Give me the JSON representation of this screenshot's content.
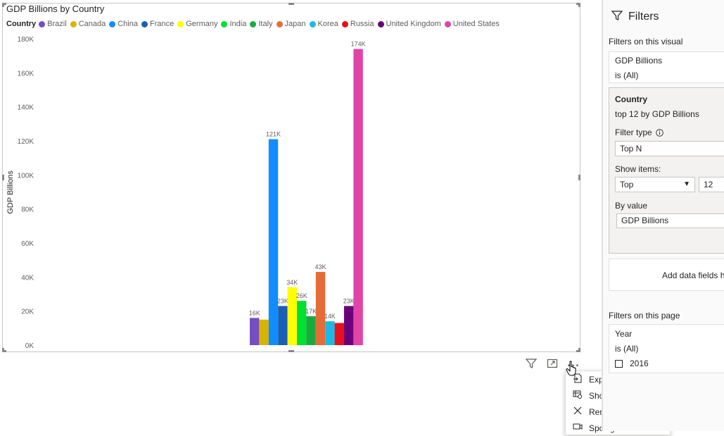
{
  "visual": {
    "title": "GDP Billions by Country",
    "legend_title": "Country",
    "y_axis_label": "GDP Billions"
  },
  "chart_data": {
    "type": "bar",
    "title": "GDP Billions by Country",
    "xlabel": "",
    "ylabel": "GDP Billions",
    "ylim": [
      0,
      180000
    ],
    "yticks": [
      "0K",
      "20K",
      "40K",
      "60K",
      "80K",
      "100K",
      "120K",
      "140K",
      "160K",
      "180K"
    ],
    "legend_position": "top-left",
    "grid": false,
    "categories": [
      "Brazil",
      "Canada",
      "China",
      "France",
      "Germany",
      "India",
      "Italy",
      "Japan",
      "Korea",
      "Russia",
      "United Kingdom",
      "United States"
    ],
    "values": [
      16000,
      15000,
      121000,
      23000,
      34000,
      26000,
      17000,
      43000,
      14000,
      13000,
      23000,
      174000
    ],
    "data_labels": [
      "16K",
      "",
      "121K",
      "23K",
      "34K",
      "26K",
      "17K",
      "43K",
      "14K",
      "",
      "23K",
      "174K"
    ],
    "colors": [
      "#744ec2",
      "#d9b300",
      "#118dff",
      "#1b5fb5",
      "#ffff00",
      "#00e02e",
      "#1aab40",
      "#e66c37",
      "#1ab9e8",
      "#e8101a",
      "#6b007b",
      "#e044a7"
    ]
  },
  "toolbar": {
    "icons": [
      "filter-icon",
      "focus-mode-icon",
      "more-options-icon"
    ],
    "more_label": "..."
  },
  "context_menu": {
    "items": [
      {
        "label": "Export data",
        "icon": "export-data-icon"
      },
      {
        "label": "Show data",
        "icon": "show-data-icon"
      },
      {
        "label": "Remove",
        "icon": "remove-icon"
      },
      {
        "label": "Spotlight",
        "icon": "spotlight-icon"
      }
    ]
  },
  "filters": {
    "title": "Filters",
    "visual_section_label": "Filters on this visual",
    "gdp_card": {
      "field": "GDP Billions",
      "condition": "is (All)"
    },
    "country_card": {
      "field": "Country",
      "summary": "top 12 by GDP Billions",
      "filter_type_label": "Filter type",
      "filter_type_value": "Top N",
      "show_items_label": "Show items:",
      "show_items_direction": "Top",
      "show_items_count": "12",
      "by_value_label": "By value",
      "by_value_field": "GDP Billions"
    },
    "add_fields_label": "Add data fields h",
    "page_section_label": "Filters on this page",
    "year_card": {
      "field": "Year",
      "condition": "is (All)",
      "options": [
        "2016"
      ]
    }
  }
}
